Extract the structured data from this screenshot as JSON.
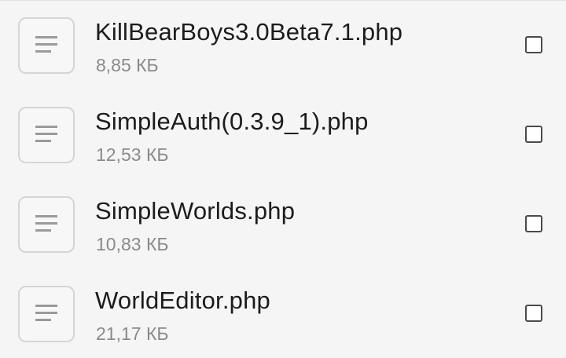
{
  "files": [
    {
      "name": "KillBearBoys3.0Beta7.1.php",
      "size": "8,85 КБ",
      "icon": "document-icon",
      "checked": false
    },
    {
      "name": "SimpleAuth(0.3.9_1).php",
      "size": "12,53 КБ",
      "icon": "document-icon",
      "checked": false
    },
    {
      "name": "SimpleWorlds.php",
      "size": "10,83 КБ",
      "icon": "document-icon",
      "checked": false
    },
    {
      "name": "WorldEditor.php",
      "size": "21,17 КБ",
      "icon": "document-icon",
      "checked": false
    }
  ]
}
